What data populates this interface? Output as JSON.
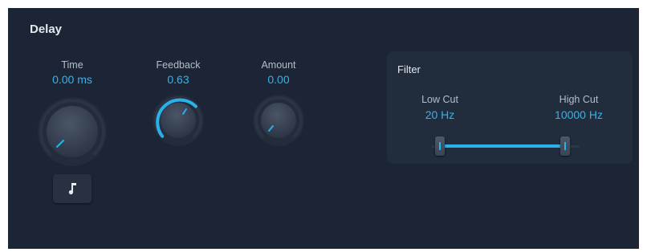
{
  "delay": {
    "title": "Delay",
    "time": {
      "label": "Time",
      "value": "0.00 ms",
      "level": 0.0
    },
    "feedback": {
      "label": "Feedback",
      "value": "0.63",
      "level": 0.63
    },
    "amount": {
      "label": "Amount",
      "value": "0.00",
      "level": 0.0
    },
    "note_sync_icon": "music-note-icon"
  },
  "filter": {
    "title": "Filter",
    "low_cut": {
      "label": "Low Cut",
      "value": "20 Hz"
    },
    "high_cut": {
      "label": "High Cut",
      "value": "10000 Hz"
    }
  },
  "colors": {
    "panel_bg": "#1b2535",
    "accent": "#2bb1ea",
    "value_text": "#33b4ea"
  }
}
